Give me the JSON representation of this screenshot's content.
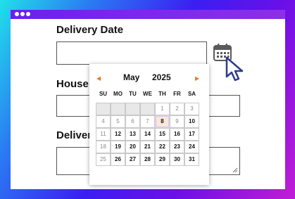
{
  "form": {
    "delivery_date_label": "Delivery Date",
    "house_label": "House S",
    "delivery_label_2": "Deliver"
  },
  "calendar": {
    "month": "May",
    "year": "2025",
    "prev": "◀",
    "next": "▶",
    "weekdays": [
      "SU",
      "MO",
      "TU",
      "WE",
      "TH",
      "FR",
      "SA"
    ],
    "today": "8",
    "weeks": [
      [
        "",
        "",
        "",
        "",
        "1",
        "2",
        "3"
      ],
      [
        "4",
        "5",
        "6",
        "7",
        "8",
        "9",
        "10"
      ],
      [
        "11",
        "12",
        "13",
        "14",
        "15",
        "16",
        "17"
      ],
      [
        "18",
        "19",
        "20",
        "21",
        "22",
        "23",
        "24"
      ],
      [
        "25",
        "26",
        "27",
        "28",
        "29",
        "30",
        "31"
      ]
    ],
    "past_days": [
      "1",
      "2",
      "3",
      "4",
      "5",
      "6",
      "7",
      "9",
      "11",
      "18",
      "25"
    ]
  },
  "icons": {
    "calendar": "calendar-icon",
    "cursor": "mouse-pointer-icon",
    "resize": "resize-grip-icon",
    "window_dots": "window-dots-icon"
  },
  "colors": {
    "accent": "#6c1ff0",
    "nav_arrow": "#e67a1f",
    "today_bg": "#fbe6d8",
    "today_border": "#d6cff0",
    "empty_cell": "#e8e8e8"
  }
}
